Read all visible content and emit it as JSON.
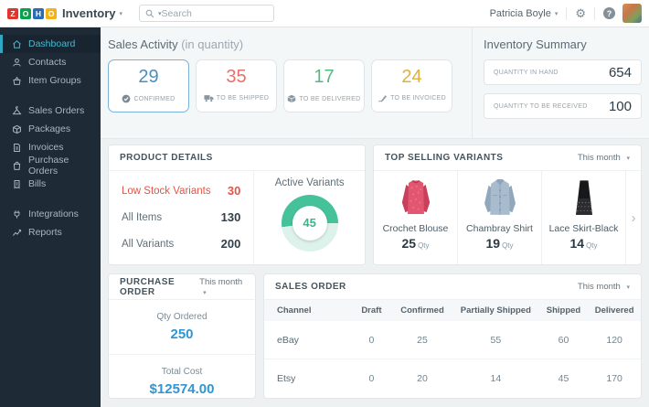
{
  "colors": {
    "sidebar_bg": "#1e2a35",
    "sidebar_active_teal": "#4db7ce",
    "accent_blue": "#4a8fc0",
    "accent_red": "#e8706a",
    "accent_green": "#53b97f",
    "accent_yellow": "#dcb13f",
    "link_blue": "#2e96d5",
    "low_stock_red": "#e0564a",
    "donut_green": "#45c29a",
    "donut_track": "#dcf2ea",
    "selected_card_border": "#7cb1d9"
  },
  "header": {
    "logo_letters": [
      {
        "char": "Z",
        "color": "#e2342c"
      },
      {
        "char": "O",
        "color": "#0ba04d"
      },
      {
        "char": "H",
        "color": "#2a6db0"
      },
      {
        "char": "O",
        "color": "#f5b217"
      }
    ],
    "app_name": "Inventory",
    "search_placeholder": "Search",
    "user_name": "Patricia Boyle",
    "help_label": "?"
  },
  "sidebar": {
    "items": [
      {
        "label": "Dashboard",
        "icon": "home-icon",
        "active": true
      },
      {
        "label": "Contacts",
        "icon": "contacts-icon"
      },
      {
        "label": "Item Groups",
        "icon": "item-groups-icon"
      },
      {
        "label": "Sales Orders",
        "icon": "sales-orders-icon"
      },
      {
        "label": "Packages",
        "icon": "packages-icon"
      },
      {
        "label": "Invoices",
        "icon": "invoices-icon"
      },
      {
        "label": "Purchase Orders",
        "icon": "purchase-orders-icon"
      },
      {
        "label": "Bills",
        "icon": "bills-icon"
      },
      {
        "label": "Integrations",
        "icon": "integrations-icon"
      },
      {
        "label": "Reports",
        "icon": "reports-icon"
      }
    ]
  },
  "sales_activity": {
    "title": "Sales Activity",
    "subtitle": "(in quantity)",
    "cards": [
      {
        "value": "29",
        "label": "CONFIRMED",
        "color": "#4a8fc0",
        "icon": "check-circle-icon",
        "selected": true
      },
      {
        "value": "35",
        "label": "TO BE SHIPPED",
        "color": "#e8706a",
        "icon": "truck-icon",
        "selected": false
      },
      {
        "value": "17",
        "label": "TO BE DELIVERED",
        "color": "#53b97f",
        "icon": "package-icon",
        "selected": false
      },
      {
        "value": "24",
        "label": "TO BE INVOICED",
        "color": "#dcb13f",
        "icon": "pen-icon",
        "selected": false
      }
    ]
  },
  "inventory_summary": {
    "title": "Inventory Summary",
    "rows": [
      {
        "label": "QUANTITY IN HAND",
        "value": "654"
      },
      {
        "label": "QUANTITY TO BE RECEIVED",
        "value": "100"
      }
    ]
  },
  "product_details": {
    "title": "PRODUCT DETAILS",
    "rows": [
      {
        "label": "Low Stock Variants",
        "value": "30",
        "alert": true
      },
      {
        "label": "All Items",
        "value": "130",
        "alert": false
      },
      {
        "label": "All Variants",
        "value": "200",
        "alert": false
      }
    ],
    "active_variants": {
      "label": "Active Variants",
      "value": "45",
      "start_deg": 262,
      "sweep_deg": 188
    }
  },
  "top_selling_variants": {
    "title": "TOP SELLING VARIANTS",
    "period": "This month",
    "qty_unit": "Qty",
    "items": [
      {
        "name": "Crochet Blouse",
        "qty": "25",
        "image": "crochet-blouse"
      },
      {
        "name": "Chambray Shirt",
        "qty": "19",
        "image": "chambray-shirt"
      },
      {
        "name": "Lace Skirt-Black",
        "qty": "14",
        "image": "lace-skirt-black"
      }
    ]
  },
  "purchase_order": {
    "title": "PURCHASE ORDER",
    "period": "This month",
    "qty_ordered_label": "Qty Ordered",
    "qty_ordered": "250",
    "total_cost_label": "Total Cost",
    "total_cost": "$12574.00"
  },
  "sales_order": {
    "title": "SALES ORDER",
    "period": "This month",
    "columns": [
      "Channel",
      "Draft",
      "Confirmed",
      "Partially Shipped",
      "Shipped",
      "Delivered"
    ],
    "rows": [
      {
        "channel": "eBay",
        "values": [
          "0",
          "25",
          "55",
          "60",
          "120"
        ]
      },
      {
        "channel": "Etsy",
        "values": [
          "0",
          "20",
          "14",
          "45",
          "170"
        ]
      }
    ]
  }
}
